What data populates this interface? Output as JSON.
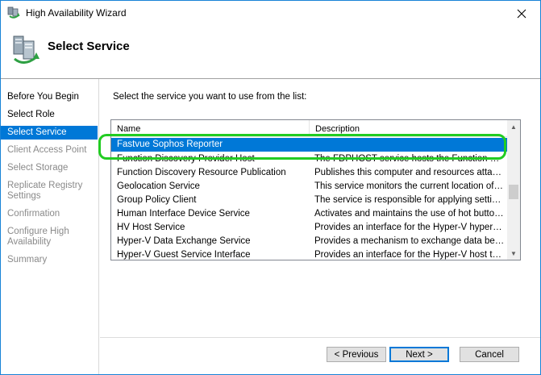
{
  "window": {
    "title": "High Availability Wizard"
  },
  "header": {
    "title": "Select Service"
  },
  "sidebar": {
    "items": [
      {
        "label": "Before You Begin",
        "state": "done"
      },
      {
        "label": "Select Role",
        "state": "done"
      },
      {
        "label": "Select Service",
        "state": "active"
      },
      {
        "label": "Client Access Point",
        "state": "pending"
      },
      {
        "label": "Select Storage",
        "state": "pending"
      },
      {
        "label": "Replicate Registry Settings",
        "state": "pending"
      },
      {
        "label": "Confirmation",
        "state": "pending"
      },
      {
        "label": "Configure High Availability",
        "state": "pending"
      },
      {
        "label": "Summary",
        "state": "pending"
      }
    ]
  },
  "main": {
    "prompt": "Select the service you want to use from the list:",
    "columns": [
      "Name",
      "Description"
    ],
    "rows": [
      {
        "name": "Fastvue Sophos Reporter",
        "description": "",
        "selected": true
      },
      {
        "name": "Function Discovery Provider Host",
        "description": "The FDPHOST service hosts the Function Disc..."
      },
      {
        "name": "Function Discovery Resource Publication",
        "description": "Publishes this computer and resources attache..."
      },
      {
        "name": "Geolocation Service",
        "description": "This service monitors the current location of the..."
      },
      {
        "name": "Group Policy Client",
        "description": "The service is responsible for applying settings ..."
      },
      {
        "name": "Human Interface Device Service",
        "description": "Activates and maintains the use of hot buttons ..."
      },
      {
        "name": "HV Host Service",
        "description": "Provides an interface for the Hyper-V hyperviso..."
      },
      {
        "name": "Hyper-V Data Exchange Service",
        "description": "Provides a mechanism to exchange data betwe..."
      },
      {
        "name": "Hyper-V Guest Service Interface",
        "description": "Provides an interface for the Hyper-V host to int..."
      }
    ]
  },
  "buttons": {
    "previous": "< Previous",
    "next": "Next >",
    "cancel": "Cancel"
  },
  "colors": {
    "accent": "#0078d7",
    "highlight": "#22cc22"
  }
}
